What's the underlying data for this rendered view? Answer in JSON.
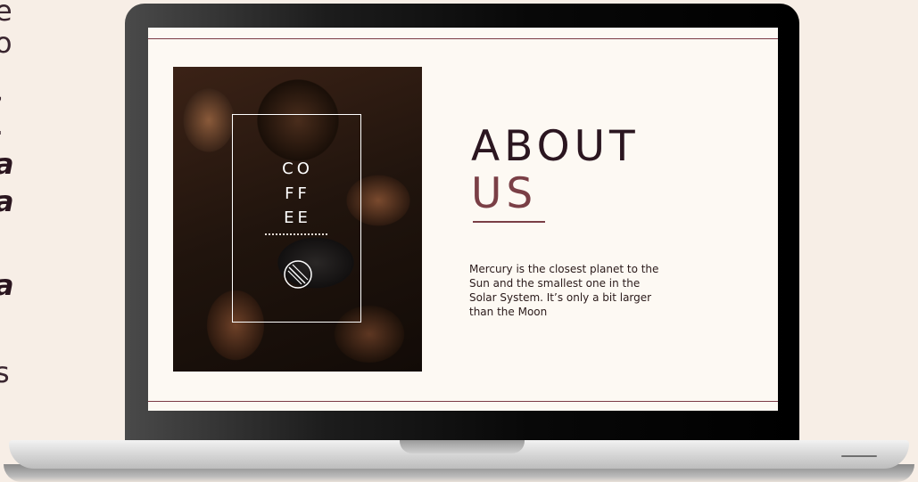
{
  "slide": {
    "badge_lines": [
      "CO",
      "FF",
      "EE"
    ],
    "title_line1": "ABOUT",
    "title_line2": "US",
    "body": "Mercury is the closest planet to the Sun and the smallest one in the Solar System. It’s only a bit larger than the Moon"
  },
  "side_text": {
    "lines": [
      "e",
      "o",
      ",",
      ".",
      "a",
      "a",
      "l",
      "a",
      "s"
    ]
  },
  "colors": {
    "background": "#f7eee6",
    "screen": "#fdf9f3",
    "title_dark": "#2b1620",
    "title_accent": "#7a3f46",
    "rule": "#7b3a44"
  },
  "icons": {
    "bean": "coffee-bean-icon"
  }
}
